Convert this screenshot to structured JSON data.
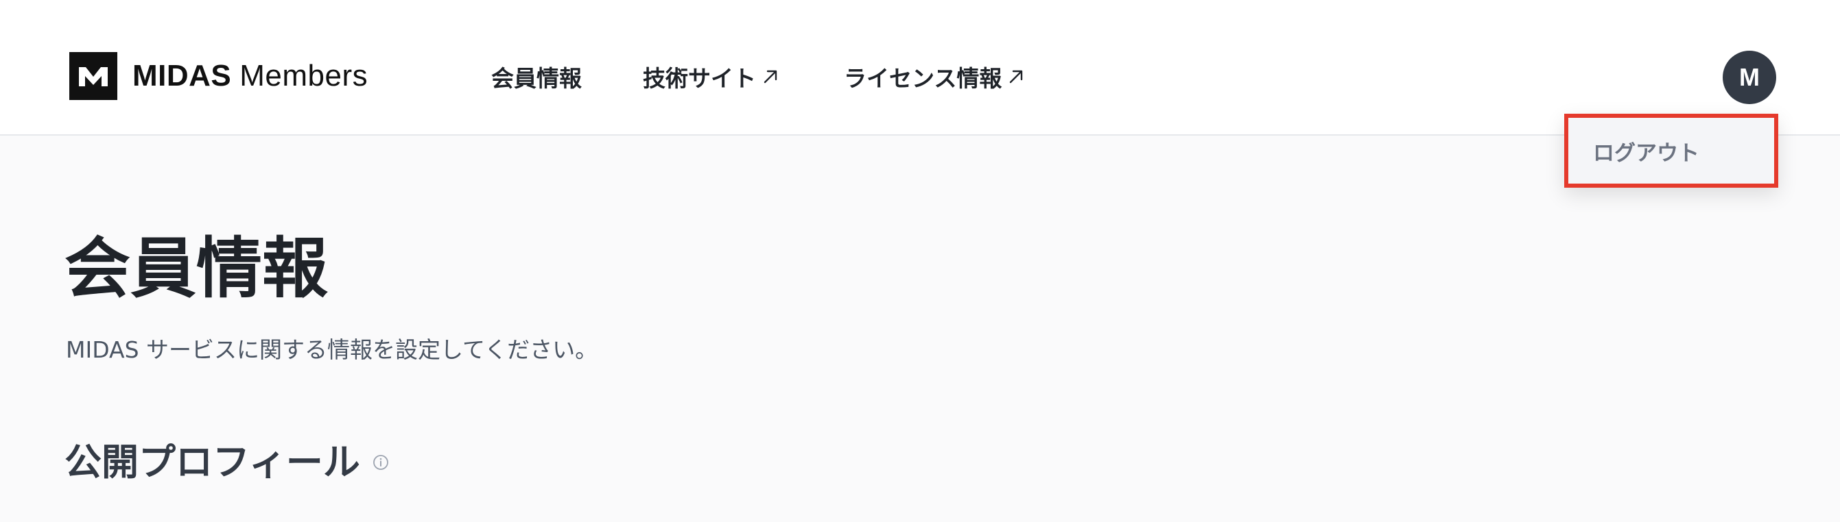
{
  "header": {
    "logo": {
      "brand": "MIDAS",
      "product": "Members"
    },
    "nav": [
      {
        "label": "会員情報",
        "icon": ""
      },
      {
        "label": "技術サイト",
        "icon": "external-link-icon"
      },
      {
        "label": "ライセンス情報",
        "icon": "external-link-icon"
      }
    ],
    "avatar_initial": "M"
  },
  "dropdown": {
    "items": [
      {
        "label": "ログアウト"
      }
    ],
    "highlight_color": "#e53a2c"
  },
  "main": {
    "title": "会員情報",
    "subtitle": "MIDAS サービスに関する情報を設定してください。",
    "section_title": "公開プロフィール",
    "section_icon": "info-icon"
  },
  "colors": {
    "avatar_bg": "#333a45",
    "page_bg": "#fafafb",
    "header_bg": "#ffffff",
    "text_primary": "#1f2329",
    "text_secondary": "#4b5563"
  }
}
